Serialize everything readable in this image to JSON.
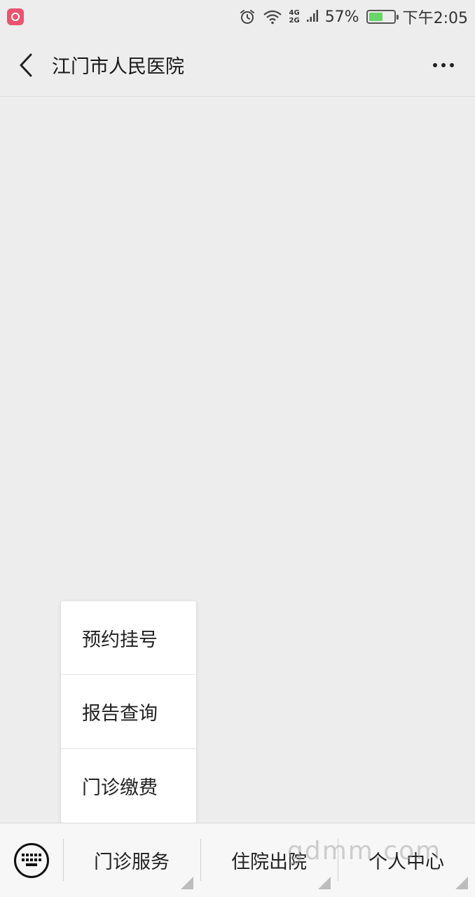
{
  "status_bar": {
    "battery_percent": "57%",
    "battery_level": 0.57,
    "network_top": "4G",
    "network_bottom": "2G",
    "time": "下午2:05",
    "icons": [
      "app-badge-icon",
      "alarm-icon",
      "wifi-icon",
      "signal-icon",
      "battery-icon"
    ]
  },
  "nav": {
    "title": "江门市人民医院",
    "back_icon": "chevron-left-icon",
    "more_icon": "more-dots-icon"
  },
  "submenu": {
    "items": [
      {
        "label": "预约挂号"
      },
      {
        "label": "报告查询"
      },
      {
        "label": "门诊缴费"
      }
    ]
  },
  "bottom_menu": {
    "keyboard_icon": "keyboard-icon",
    "tabs": [
      {
        "label": "门诊服务"
      },
      {
        "label": "住院出院"
      },
      {
        "label": "个人中心"
      }
    ]
  },
  "watermark": "gdmm.com",
  "colors": {
    "background": "#ededed",
    "app_badge": "#ea5470",
    "battery_fill": "#6ad46a"
  }
}
